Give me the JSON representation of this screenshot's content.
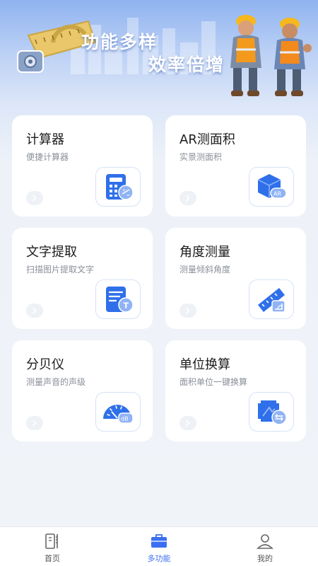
{
  "banner": {
    "line1": "功能多样",
    "line2": "效率倍增"
  },
  "cards": [
    {
      "title": "计算器",
      "subtitle": "便捷计算器",
      "icon": "calculator-icon"
    },
    {
      "title": "AR测面积",
      "subtitle": "实景测面积",
      "icon": "ar-cube-icon",
      "icon_text": "AR"
    },
    {
      "title": "文字提取",
      "subtitle": "扫描图片提取文字",
      "icon": "text-extract-icon",
      "icon_text": "T"
    },
    {
      "title": "角度测量",
      "subtitle": "测量倾斜角度",
      "icon": "angle-ruler-icon"
    },
    {
      "title": "分贝仪",
      "subtitle": "测量声音的声级",
      "icon": "decibel-meter-icon",
      "icon_text": "dB"
    },
    {
      "title": "单位换算",
      "subtitle": "面积单位一键换算",
      "icon": "unit-convert-icon"
    }
  ],
  "tabbar": {
    "tabs": [
      {
        "label": "首页",
        "icon": "home-ruler-icon"
      },
      {
        "label": "多功能",
        "icon": "toolbox-icon",
        "active": true
      },
      {
        "label": "我的",
        "icon": "user-icon"
      }
    ],
    "active_color": "#3b6ff2"
  },
  "colors": {
    "accent": "#3b6ff2",
    "icon_blue": "#2f6fea"
  }
}
